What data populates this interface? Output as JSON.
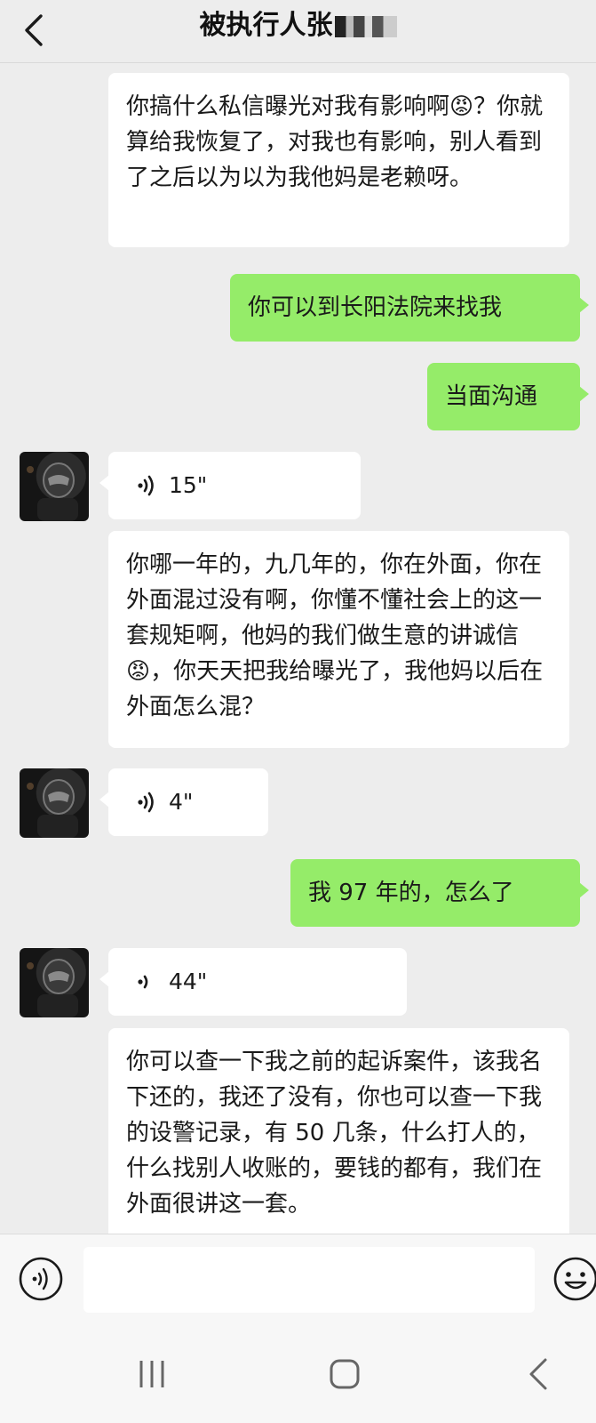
{
  "header": {
    "title": "被执行人张",
    "title_redacted": true
  },
  "messages": [
    {
      "side": "left",
      "type": "text",
      "text": "你搞什么私信曝光对我有影响啊😡？你就算给我恢复了，对我也有影响，别人看到了之后以为以为我他妈是老赖呀。"
    },
    {
      "side": "right",
      "type": "text",
      "text": "你可以到长阳法院来找我"
    },
    {
      "side": "right",
      "type": "text",
      "text": "当面沟通"
    },
    {
      "side": "left",
      "type": "voice",
      "duration": "15\""
    },
    {
      "side": "left",
      "type": "text",
      "text": "你哪一年的，九几年的，你在外面，你在外面混过没有啊，你懂不懂社会上的这一套规矩啊，他妈的我们做生意的讲诚信😡，你天天把我给曝光了，我他妈以后在外面怎么混？"
    },
    {
      "side": "left",
      "type": "voice",
      "duration": "4\""
    },
    {
      "side": "right",
      "type": "text",
      "text": "我 97 年的，怎么了"
    },
    {
      "side": "left",
      "type": "voice",
      "duration": "44\""
    },
    {
      "side": "left",
      "type": "text",
      "text": "你可以查一下我之前的起诉案件，该我名下还的，我还了没有，你也可以查一下我的设警记录，有 50 几条，什么打人的，什么找别人收账的，要钱的都有，我们在外面很讲这一套。"
    }
  ],
  "colors": {
    "background": "#ededed",
    "sent_bubble": "#95ec69",
    "received_bubble": "#ffffff"
  },
  "icons": [
    "back-icon",
    "voice-wave-icon",
    "emoji-icon",
    "recent-apps-icon",
    "home-icon",
    "nav-back-icon"
  ]
}
